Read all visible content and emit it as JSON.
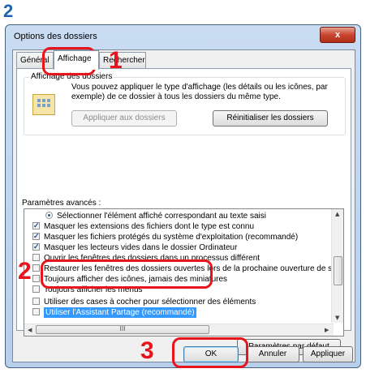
{
  "step_label": "2",
  "dialog": {
    "title": "Options des dossiers",
    "close_symbol": "x"
  },
  "tabs": [
    {
      "label": "Général"
    },
    {
      "label": "Affichage"
    },
    {
      "label": "Rechercher"
    }
  ],
  "folder_views": {
    "group_title": "Affichage des dossiers",
    "description": "Vous pouvez appliquer le type d'affichage (les détails ou les icônes, par exemple) de ce dossier à tous les dossiers du même type.",
    "apply_button": "Appliquer aux dossiers",
    "reset_button": "Réinitialiser les dossiers"
  },
  "advanced": {
    "label": "Paramètres avancés :",
    "items": [
      {
        "type": "radio",
        "checked": true,
        "label": "Sélectionner l'élément affiché correspondant au texte saisi"
      },
      {
        "type": "checkbox",
        "checked": true,
        "label": "Masquer les extensions des fichiers dont le type est connu"
      },
      {
        "type": "checkbox",
        "checked": true,
        "label": "Masquer les fichiers protégés du système d'exploitation (recommandé)"
      },
      {
        "type": "checkbox",
        "checked": true,
        "label": "Masquer les lecteurs vides dans le dossier Ordinateur"
      },
      {
        "type": "checkbox",
        "checked": false,
        "label": "Ouvrir les fenêtres des dossiers dans un processus différent"
      },
      {
        "type": "checkbox",
        "checked": false,
        "label": "Restaurer les fenêtres des dossiers ouvertes lors de la prochaine ouverture de se"
      },
      {
        "type": "checkbox",
        "checked": false,
        "label": "Toujours afficher des icônes, jamais des miniatures"
      },
      {
        "type": "checkbox",
        "checked": false,
        "label": "Toujours afficher les menus"
      },
      {
        "type": "checkbox",
        "checked": false,
        "label": "Utiliser des cases à cocher pour sélectionner des éléments"
      },
      {
        "type": "checkbox",
        "checked": false,
        "label": "Utiliser l'Assistant Partage (recommandé)"
      }
    ],
    "hscroll_grip": "III"
  },
  "buttons": {
    "defaults": "Paramètres par défaut",
    "ok": "OK",
    "cancel": "Annuler",
    "apply": "Appliquer"
  },
  "callouts": {
    "tab": "1",
    "option": "2",
    "ok": "3"
  },
  "colors": {
    "callout_red": "#e8141b",
    "step_blue": "#1e62b0",
    "selection_blue": "#3399ff"
  }
}
